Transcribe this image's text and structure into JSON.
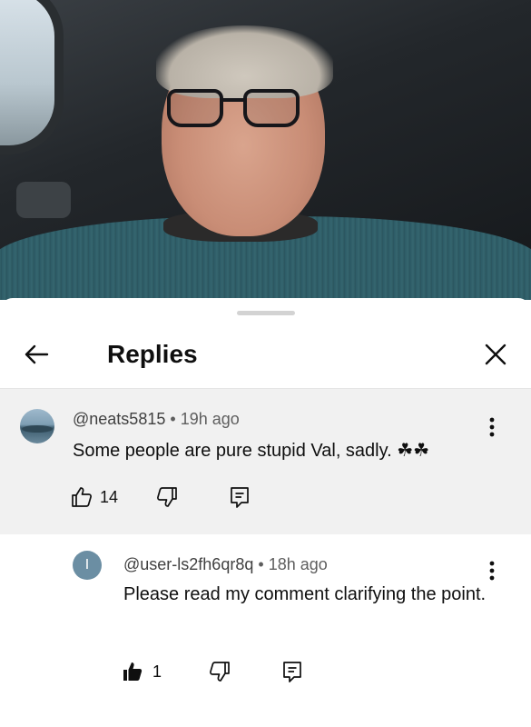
{
  "sheet": {
    "title": "Replies"
  },
  "comments": [
    {
      "handle": "@neats5815",
      "separator": "•",
      "time": "19h ago",
      "text": "Some people are pure stupid Val, sadly. ☘☘",
      "likes": "14",
      "liked": false
    },
    {
      "avatar_letter": "I",
      "handle": "@user-ls2fh6qr8q",
      "separator": "•",
      "time": "18h ago",
      "text": "Please read my comment clarifying the point.",
      "likes": "1",
      "liked": true
    }
  ],
  "icons": {
    "back": "arrow-left-icon",
    "close": "close-icon",
    "more": "more-vert-icon",
    "like": "thumb-up-icon",
    "dislike": "thumb-down-icon",
    "reply": "reply-icon"
  },
  "colors": {
    "highlight_bg": "#f1f1f1",
    "avatar_letter_bg": "#6b8ea3"
  }
}
